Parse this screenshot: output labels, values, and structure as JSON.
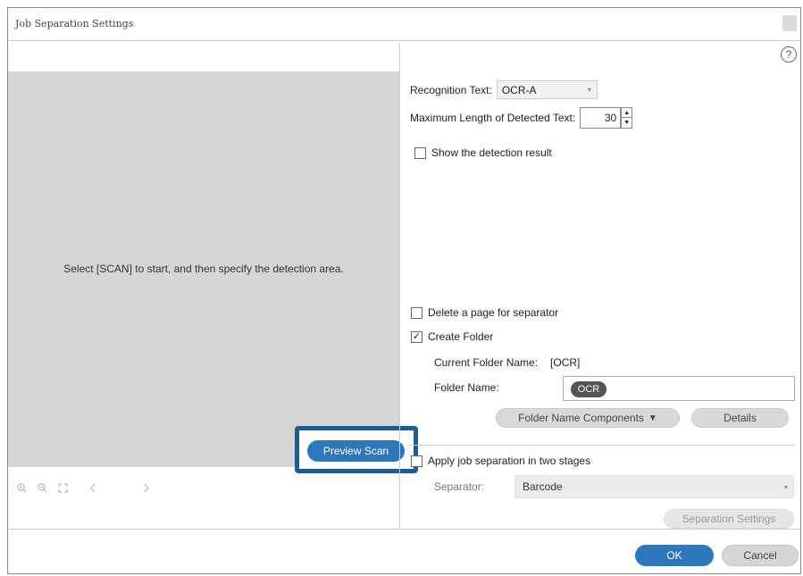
{
  "window": {
    "title": "Job Separation Settings"
  },
  "preview": {
    "hint": "Select [SCAN] to start, and then specify the detection area.",
    "toolbar_icons": [
      "zoom-in-icon",
      "zoom-out-icon",
      "fit-page-icon",
      "previous-page-icon",
      "next-page-icon"
    ],
    "preview_scan_label": "Preview Scan"
  },
  "settings": {
    "help_symbol": "?",
    "recognition_text_label": "Recognition Text:",
    "recognition_text_value": "OCR-A",
    "max_length_label": "Maximum Length of Detected Text:",
    "max_length_value": "30",
    "show_detection_label": "Show the detection result",
    "show_detection_checked": false,
    "delete_page_label": "Delete a page for separator",
    "delete_page_checked": false,
    "create_folder_label": "Create Folder",
    "create_folder_checked": true,
    "current_folder_label": "Current Folder Name:",
    "current_folder_value": "[OCR]",
    "folder_name_label": "Folder Name:",
    "folder_name_chip": "OCR",
    "folder_components_label": "Folder Name Components",
    "folder_components_arrow": "▼",
    "details_label": "Details",
    "two_stages_label": "Apply job separation in two stages",
    "two_stages_checked": false,
    "separator_label": "Separator:",
    "separator_value": "Barcode",
    "separation_settings_label": "Separation Settings"
  },
  "footer": {
    "ok_label": "OK",
    "cancel_label": "Cancel"
  },
  "colors": {
    "accent": "#2f77bd",
    "highlight": "#1f5c96",
    "preview_bg": "#d6d6d6"
  }
}
